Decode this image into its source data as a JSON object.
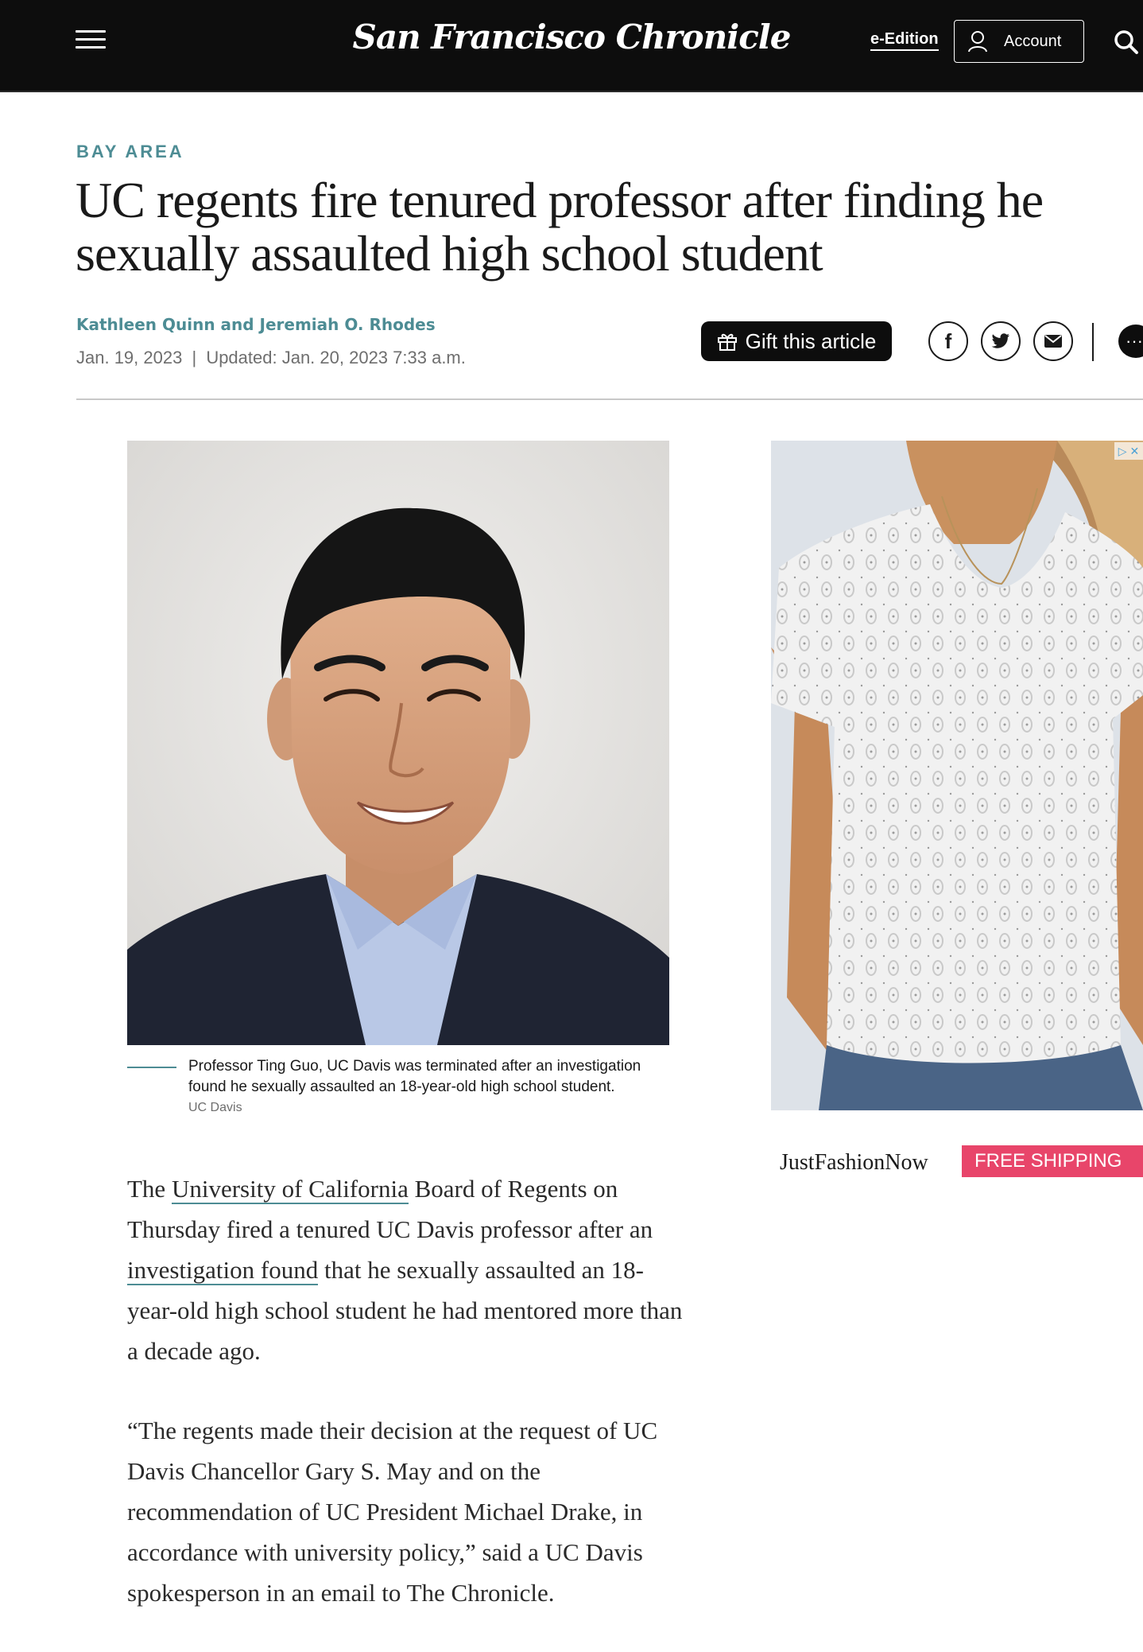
{
  "header": {
    "logo": "San Francisco Chronicle",
    "eedition_label": "e-Edition",
    "account_label": "Account"
  },
  "article": {
    "section": "BAY AREA",
    "headline_line1": "UC regents fire tenured professor after finding he",
    "headline_line2": "sexually assaulted high school student",
    "byline": "Kathleen Quinn and Jeremiah O. Rhodes",
    "date": "Jan. 19, 2023",
    "date_separator": "|",
    "updated": "Updated: Jan. 20, 2023 7:33 a.m.",
    "gift_label": "Gift this article",
    "more_label": "···"
  },
  "photo": {
    "caption_line1": "Professor Ting Guo, UC Davis was terminated after an investigation",
    "caption_line2": "found he sexually assaulted an 18-year-old high school student.",
    "credit": "UC Davis"
  },
  "body": {
    "p1_pre": "The ",
    "p1_link1": "University of California",
    "p1_mid": " Board of Regents on Thursday fired a tenured UC Davis professor after an ",
    "p1_link2": "investigation found",
    "p1_post": " that he sexually assaulted an 18-year-old high school student he had mentored more than a decade ago.",
    "p2": "“The regents made their decision at the request of UC Davis Chancellor Gary S. May and on the recommendation of UC President Michael Drake, in accordance with university policy,” said a UC Davis spokesperson in an email to The Chronicle."
  },
  "ad": {
    "brand": "JustFashionNow",
    "cta": "FREE SHIPPING",
    "adchoice": "▷ ✕"
  },
  "colors": {
    "accent": "#4d8c94",
    "topbar": "#0d0d0d",
    "ad_cta": "#e8456a"
  },
  "icons": [
    "menu-icon",
    "user-icon",
    "search-icon",
    "gift-icon",
    "facebook-icon",
    "twitter-icon",
    "email-icon",
    "more-icon"
  ]
}
